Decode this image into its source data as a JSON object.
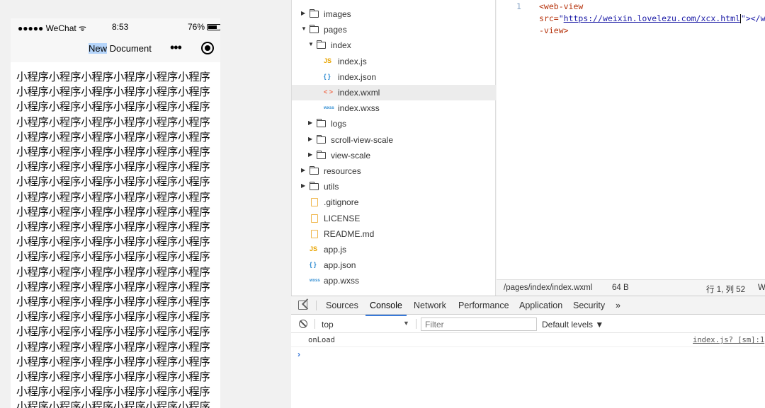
{
  "simulator": {
    "status": {
      "signal": "●●●●● WeChat ᯤ",
      "time": "8:53",
      "battery": "76%"
    },
    "nav": {
      "title_selected": "New",
      "title_rest": " Document",
      "more": "•••"
    },
    "content_lines": [
      "小程序小程序小程序小程序小程序小程序",
      "小程序小程序小程序小程序小程序小程序",
      "小程序小程序小程序小程序小程序小程序",
      "小程序小程序小程序小程序小程序小程序",
      "小程序小程序小程序小程序小程序小程序",
      "小程序小程序小程序小程序小程序小程序",
      "小程序小程序小程序小程序小程序小程序",
      "小程序小程序小程序小程序小程序小程序",
      "小程序小程序小程序小程序小程序小程序",
      "小程序小程序小程序小程序小程序小程序",
      "小程序小程序小程序小程序小程序小程序",
      "小程序小程序小程序小程序小程序小程序",
      "小程序小程序小程序小程序小程序小程序",
      "小程序小程序小程序小程序小程序小程序",
      "小程序小程序小程序小程序小程序小程序",
      "小程序小程序小程序小程序小程序小程序",
      "小程序小程序小程序小程序小程序小程序",
      "小程序小程序小程序小程序小程序小程序",
      "小程序小程序小程序小程序小程序小程序",
      "小程序小程序小程序小程序小程序小程序",
      "小程序小程序小程序小程序小程序小程序",
      "小程序小程序小程序小程序小程序小程序",
      "小程序小程序小程序小程序小程序小程序"
    ]
  },
  "tree": [
    {
      "label": "images",
      "kind": "folder",
      "expanded": false
    },
    {
      "label": "pages",
      "kind": "folder",
      "expanded": true
    },
    {
      "label": "index",
      "kind": "folder",
      "expanded": true
    },
    {
      "label": "index.js",
      "kind": "js",
      "badge": "JS"
    },
    {
      "label": "index.json",
      "kind": "json",
      "badge": "{ }"
    },
    {
      "label": "index.wxml",
      "kind": "wxml",
      "badge": "< >",
      "active": true
    },
    {
      "label": "index.wxss",
      "kind": "wxss",
      "badge": "wxss"
    },
    {
      "label": "logs",
      "kind": "folder",
      "expanded": false
    },
    {
      "label": "scroll-view-scale",
      "kind": "folder",
      "expanded": false
    },
    {
      "label": "view-scale",
      "kind": "folder",
      "expanded": false
    },
    {
      "label": "resources",
      "kind": "folder",
      "expanded": false
    },
    {
      "label": "utils",
      "kind": "folder",
      "expanded": false
    },
    {
      "label": ".gitignore",
      "kind": "file"
    },
    {
      "label": "LICENSE",
      "kind": "file"
    },
    {
      "label": "README.md",
      "kind": "file"
    },
    {
      "label": "app.js",
      "kind": "js",
      "badge": "JS"
    },
    {
      "label": "app.json",
      "kind": "json",
      "badge": "{ }"
    },
    {
      "label": "app.wxss",
      "kind": "wxss",
      "badge": "wxss"
    }
  ],
  "editor": {
    "line_number": "1",
    "line1": "<web-view",
    "line2_attr": "src=",
    "line2_q1": "\"",
    "line2_url": "https://weixin.lovelezu.com/xcx.html",
    "line2_q2": "\"></w",
    "line3": "-view>",
    "status": {
      "path": "/pages/index/index.wxml",
      "size": "64 B",
      "cursor": "行 1, 列 52",
      "extra": "W"
    }
  },
  "devtools": {
    "tabs": [
      "Sources",
      "Console",
      "Network",
      "Performance",
      "Application",
      "Security",
      "»"
    ],
    "active_tab": "Console",
    "context": "top",
    "context_arrow": "▼",
    "filter_placeholder": "Filter",
    "levels": "Default levels ▼",
    "log": {
      "message": "onLoad",
      "source": "index.js? [sm]:1"
    },
    "prompt": "›"
  }
}
